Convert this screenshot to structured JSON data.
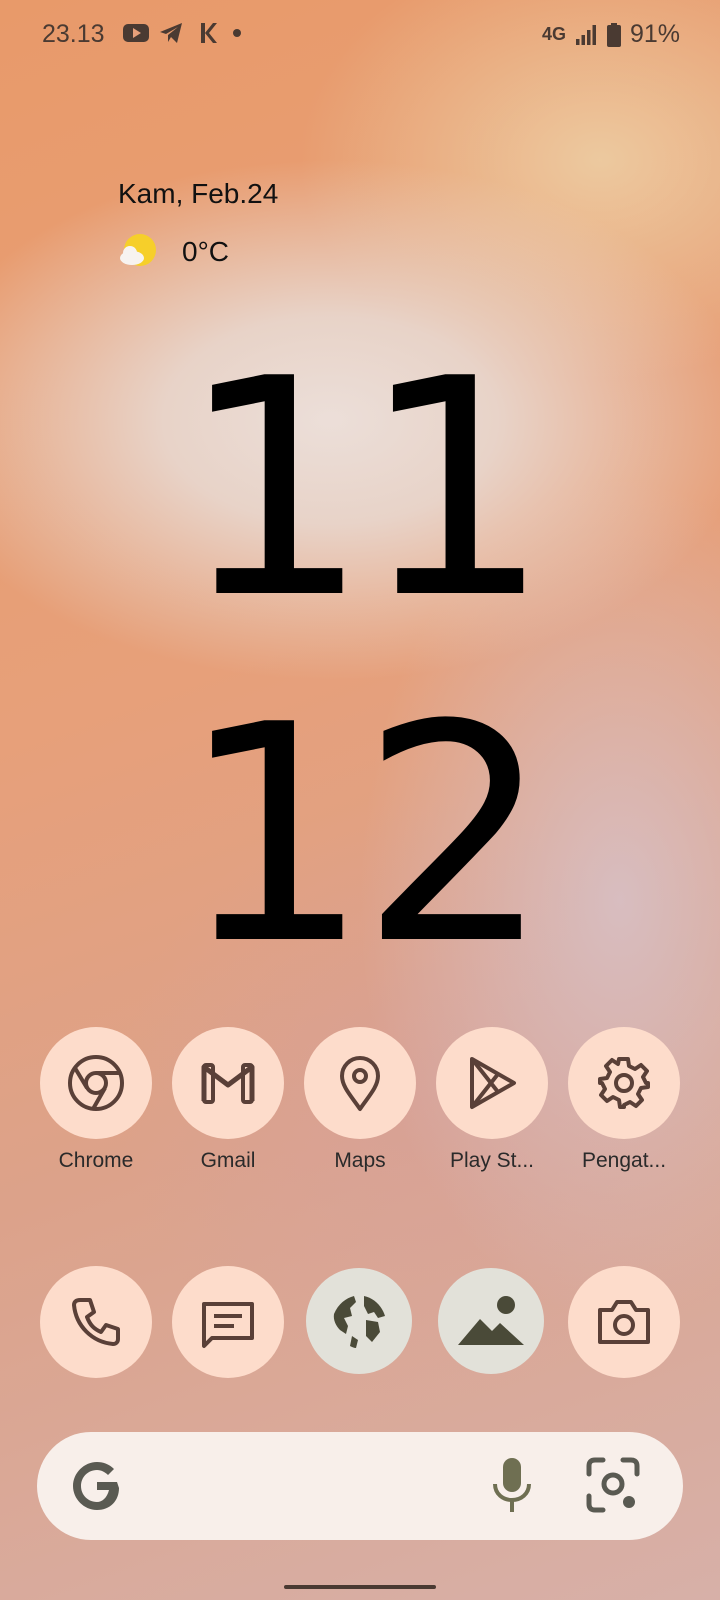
{
  "status_bar": {
    "time": "23.13",
    "notification_icons": [
      "youtube-icon",
      "telegram-icon",
      "k-app-icon",
      "dot-icon"
    ],
    "network": "4G",
    "battery": "91%"
  },
  "date_widget": {
    "date": "Kam, Feb.24"
  },
  "weather": {
    "icon": "partly-cloudy-icon",
    "temperature": "0°C"
  },
  "clock": {
    "hours": "11",
    "minutes": "12"
  },
  "apps_row": [
    {
      "label": "Chrome",
      "icon": "chrome-icon"
    },
    {
      "label": "Gmail",
      "icon": "gmail-icon"
    },
    {
      "label": "Maps",
      "icon": "maps-pin-icon"
    },
    {
      "label": "Play St...",
      "icon": "play-store-icon"
    },
    {
      "label": "Pengat...",
      "icon": "settings-gear-icon"
    }
  ],
  "dock": [
    {
      "icon": "phone-icon"
    },
    {
      "icon": "messages-icon"
    },
    {
      "icon": "browser-globe-icon"
    },
    {
      "icon": "gallery-icon"
    },
    {
      "icon": "camera-icon"
    }
  ],
  "search_bar": {
    "icons": [
      "google-g-icon",
      "mic-icon",
      "lens-icon"
    ]
  },
  "colors": {
    "icon_bg": "#fddccb",
    "icon_fg": "#5a4038",
    "dock_gray": "#e2e1d9"
  }
}
